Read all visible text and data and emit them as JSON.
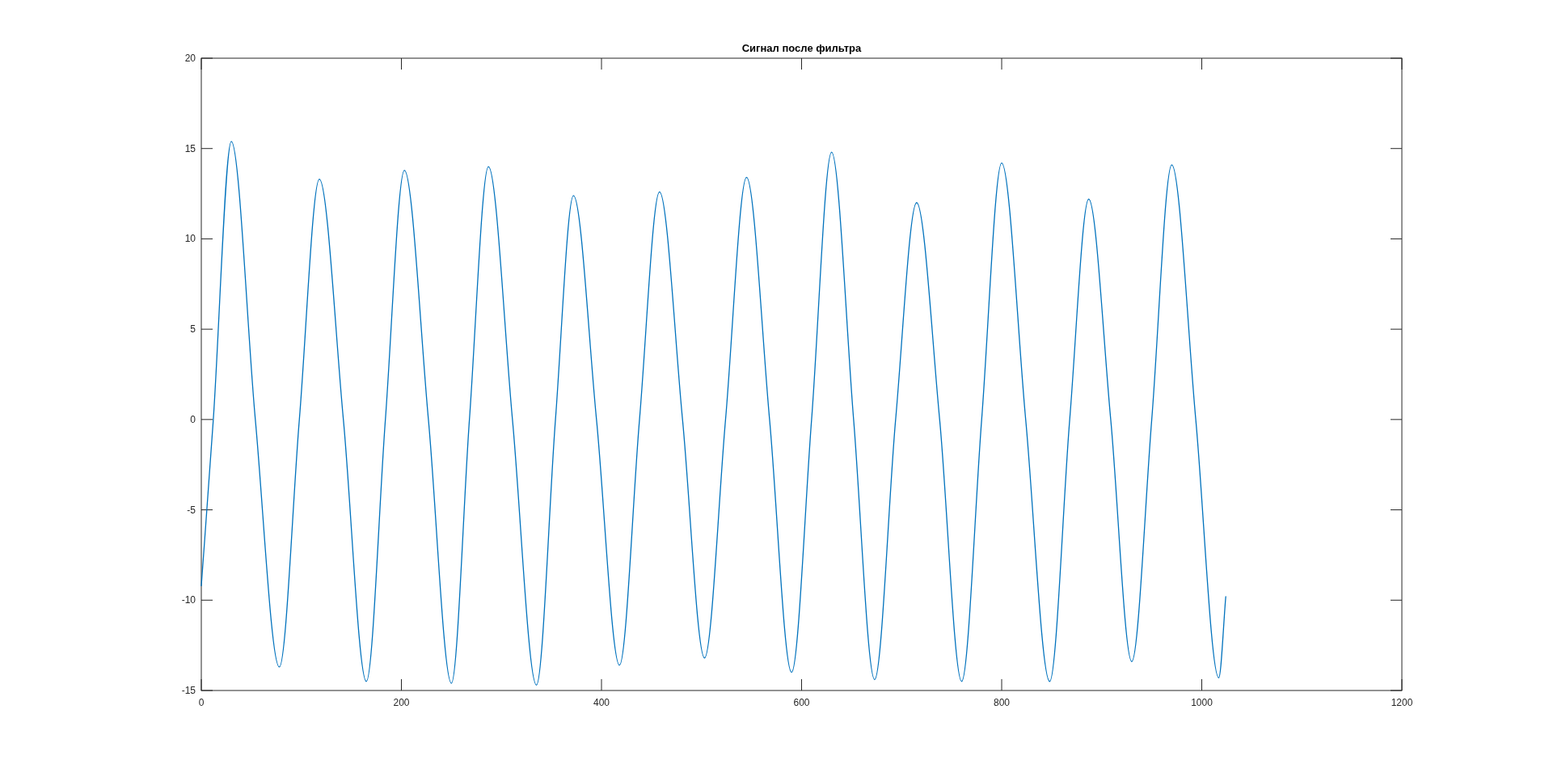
{
  "figure": {
    "chart_data": {
      "type": "line",
      "title": "Сигнал после фильтра",
      "x": [
        0,
        12,
        30,
        54,
        78,
        98,
        118,
        142,
        165,
        184,
        203,
        227,
        250,
        268,
        287,
        311,
        335,
        354,
        372,
        395,
        418,
        438,
        458,
        481,
        503,
        524,
        545,
        568,
        590,
        610,
        630,
        652,
        673,
        694,
        715,
        738,
        760,
        780,
        800,
        824,
        848,
        868,
        887,
        909,
        930,
        950,
        970,
        994,
        1017,
        1024
      ],
      "series": [
        {
          "color": "#0072bd",
          "values": [
            -9.2,
            0,
            15.4,
            0,
            -13.7,
            0,
            13.3,
            0,
            -14.5,
            0,
            13.8,
            0,
            -14.6,
            0,
            14.0,
            0,
            -14.7,
            0,
            12.4,
            0,
            -13.6,
            0,
            12.6,
            0,
            -13.2,
            0,
            13.4,
            0,
            -14.0,
            0,
            14.8,
            0,
            -14.4,
            0,
            12.0,
            0,
            -14.5,
            0,
            14.2,
            0,
            -14.5,
            0,
            12.2,
            0,
            -13.4,
            0,
            14.1,
            0,
            -14.3,
            -9.8
          ]
        }
      ],
      "xlim": [
        0,
        1200
      ],
      "ylim": [
        -15,
        20
      ],
      "xticks": [
        0,
        200,
        400,
        600,
        800,
        1000,
        1200
      ],
      "yticks": [
        -15,
        -10,
        -5,
        0,
        5,
        10,
        15,
        20
      ]
    }
  }
}
